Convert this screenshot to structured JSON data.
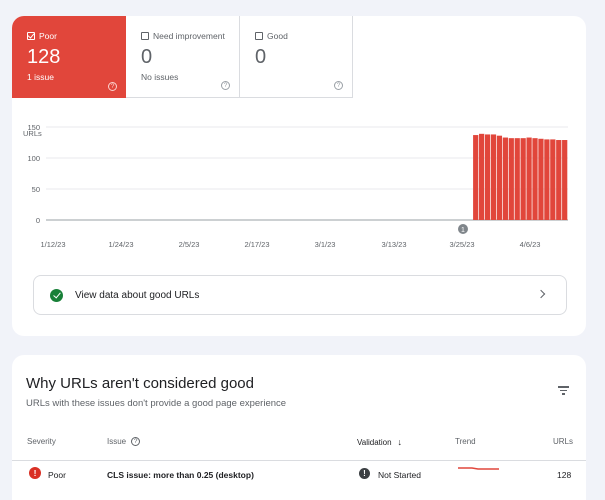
{
  "tiles": {
    "poor": {
      "label": "Poor",
      "value": "128",
      "sub": "1 issue"
    },
    "need": {
      "label": "Need improvement",
      "value": "0",
      "sub": "No issues"
    },
    "good": {
      "label": "Good",
      "value": "0",
      "sub": ""
    }
  },
  "colors": {
    "poor": "#e1463b",
    "good": "#188038",
    "text_secondary": "#5f6368"
  },
  "chart_data": {
    "type": "bar",
    "ylabel": "URLs",
    "ylim": [
      0,
      150
    ],
    "yticks": [
      "150",
      "100",
      "50",
      "0"
    ],
    "xticks": [
      "1/12/23",
      "1/24/23",
      "2/5/23",
      "2/17/23",
      "3/1/23",
      "3/13/23",
      "3/25/23",
      "4/6/23"
    ],
    "annotation": "1",
    "series": [
      {
        "values": [
          0,
          0,
          0,
          0,
          0,
          0,
          0,
          0,
          0,
          0,
          0,
          0,
          0,
          0,
          0,
          0,
          0,
          0,
          0,
          0,
          0,
          0,
          0,
          0,
          0,
          0,
          0,
          0,
          0,
          0,
          0,
          0,
          0,
          0,
          0,
          0,
          0,
          0,
          0,
          0,
          0,
          0,
          0,
          0,
          0,
          0,
          0,
          0,
          0,
          0,
          0,
          0,
          0,
          0,
          0,
          0,
          0,
          0,
          0,
          0,
          0,
          0,
          0,
          0,
          0,
          0,
          0,
          0,
          0,
          0,
          0,
          0,
          137,
          139,
          138,
          138,
          136,
          133,
          132,
          132,
          132,
          133,
          132,
          131,
          130,
          130,
          129,
          129
        ]
      }
    ]
  },
  "good_urls_button": {
    "label": "View data about good URLs"
  },
  "issues": {
    "title": "Why URLs aren't considered good",
    "subtitle": "URLs with these issues don't provide a good page experience",
    "headers": {
      "severity": "Severity",
      "issue": "Issue",
      "validation": "Validation",
      "trend": "Trend",
      "urls": "URLs"
    },
    "rows": [
      {
        "severity": "Poor",
        "issue": "CLS issue: more than 0.25 (desktop)",
        "validation": "Not Started",
        "urls": "128"
      }
    ]
  }
}
